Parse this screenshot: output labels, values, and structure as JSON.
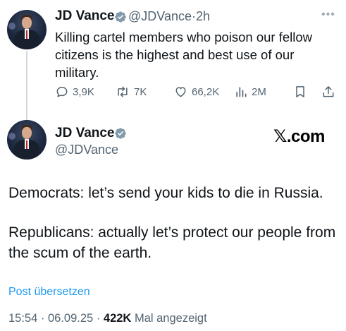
{
  "tweet_reply": {
    "name": "JD Vance",
    "handle": "@JDVance",
    "separator": "·",
    "age": "2h",
    "more": "•••",
    "text": "Killing cartel members who poison our fellow citizens is the highest and best use of our military.",
    "actions": {
      "replies": "3,9K",
      "reposts": "7K",
      "likes": "66,2K",
      "views": "2M"
    }
  },
  "tweet_main": {
    "name": "JD Vance",
    "handle": "@JDVance",
    "watermark": "𝕏.com",
    "text_paragraph_1": "Democrats: let’s send your kids to die in Russia.",
    "text_paragraph_2": "Republicans: actually let’s protect our people from the scum of the earth.",
    "translate_link": "Post übersetzen",
    "meta": {
      "time": "15:54",
      "dot": "·",
      "date": "06.09.25",
      "views_count": "422K",
      "views_label": "Mal angezeigt"
    }
  },
  "colors": {
    "text": "#0f1419",
    "secondary": "#536471",
    "link": "#1d9bf0",
    "verified_badge": "#829aab"
  },
  "icons": [
    "verified-badge-icon",
    "reply-icon",
    "repost-icon",
    "like-icon",
    "views-icon",
    "bookmark-icon",
    "share-icon",
    "more-icon"
  ]
}
